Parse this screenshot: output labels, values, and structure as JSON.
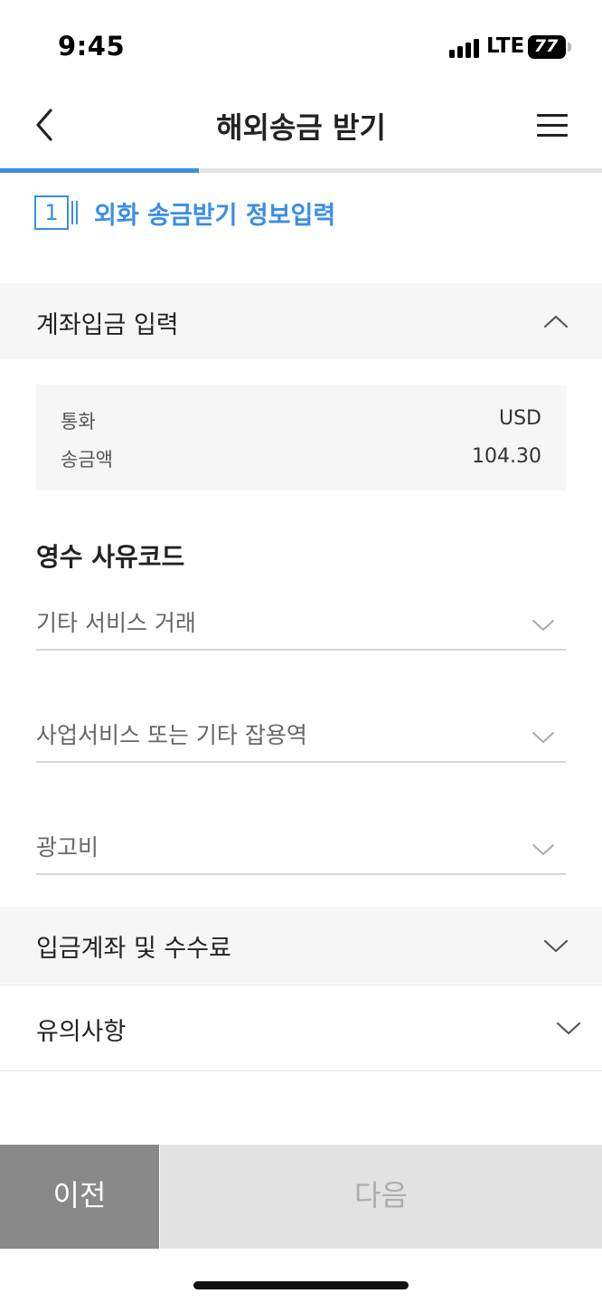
{
  "status_bar": {
    "time": "9:45",
    "network": "LTE",
    "battery": "77"
  },
  "header": {
    "title": "해외송금 받기",
    "back_icon": "chevron-left-icon",
    "menu_icon": "hamburger-menu-icon"
  },
  "progress": {
    "fraction": 0.33,
    "accent_color": "#3a8ee6"
  },
  "step": {
    "number": "1",
    "title": "외화 송금받기 정보입력"
  },
  "account_deposit_section": {
    "title": "계좌입금 입력",
    "expanded": true,
    "currency_label": "통화",
    "currency_value": "USD",
    "amount_label": "송금액",
    "amount_value": "104.30"
  },
  "receipt_reason": {
    "title": "영수 사유코드",
    "selects": [
      {
        "value": "기타 서비스 거래"
      },
      {
        "value": "사업서비스 또는 기타 잡용역"
      },
      {
        "value": "광고비"
      }
    ]
  },
  "deposit_account_section": {
    "title": "입금계좌 및 수수료",
    "expanded": false
  },
  "notice_section": {
    "title": "유의사항",
    "expanded": false
  },
  "buttons": {
    "prev": "이전",
    "next": "다음"
  }
}
